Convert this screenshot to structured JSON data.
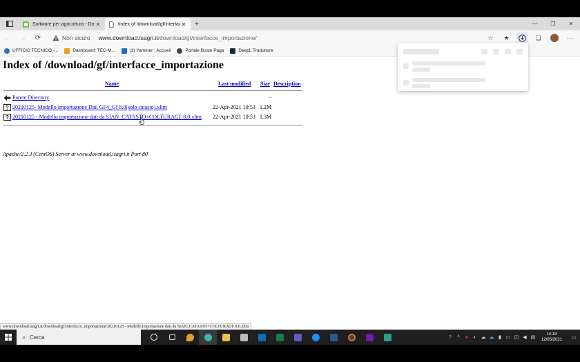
{
  "browser": {
    "tabs": [
      {
        "title": "Software per agricoltura - Down",
        "active": false
      },
      {
        "title": "Index of /download/gf/interfacc",
        "active": true
      }
    ],
    "address": {
      "security_label": "Non sicuro",
      "host": "www.download.isagri.it",
      "path": "/download/gf/interfacce_importazione/"
    },
    "favorites": [
      {
        "label": "UFFICIO TECNICO -...",
        "icon": "office-icon",
        "color": "#2d6fb8"
      },
      {
        "label": "Dashboard: TEC-M...",
        "icon": "dashboard-icon",
        "color": "#e8a317"
      },
      {
        "label": "(1) Yammer : Accueil",
        "icon": "yammer-icon",
        "color": "#1f6fc5"
      },
      {
        "label": "Portale Buste Paga",
        "icon": "payroll-icon",
        "color": "#444444"
      },
      {
        "label": "DeepL Traduttore",
        "icon": "deepl-icon",
        "color": "#0f2b46"
      }
    ]
  },
  "page": {
    "title": "Index of /download/gf/interfacce_importazione",
    "columns": {
      "name": "Name",
      "modified": "Last modified",
      "size": "Size",
      "description": "Description"
    },
    "rows": [
      {
        "name": "Parent Directory",
        "modified": "",
        "size": "-",
        "icon": "back-folder-icon"
      },
      {
        "name": "20210125- Modello importazione Dati GF4_Gf 8.0(solo catasto).xltm",
        "modified": "22-Apr-2021 10:53",
        "size": "1.2M",
        "icon": "unknown-file-icon"
      },
      {
        "name": "20210125 - Modello importazione dati da SIAN_CATASTO+COLTURAGF 8.0.xltm",
        "modified": "22-Apr-2021 10:53",
        "size": "1.3M",
        "icon": "unknown-file-icon"
      }
    ],
    "server_signature": "Apache/2.2.3 (CentOS) Server at www.download.isagri.it Port 80"
  },
  "status_url": "www.download.isagri.it/download/gf/interfacce_importazione/20210125 - Modello importazione dati da SIAN_CATASTO+COLTURAGF 8.0.xltm",
  "taskbar": {
    "search_placeholder": "Cerca",
    "clock_time": "14:19",
    "clock_date": "12/05/2021"
  },
  "colors": {
    "link": "#0000cc",
    "taskbar": "#1f1f1f",
    "tab_strip": "#dcdcdc"
  }
}
